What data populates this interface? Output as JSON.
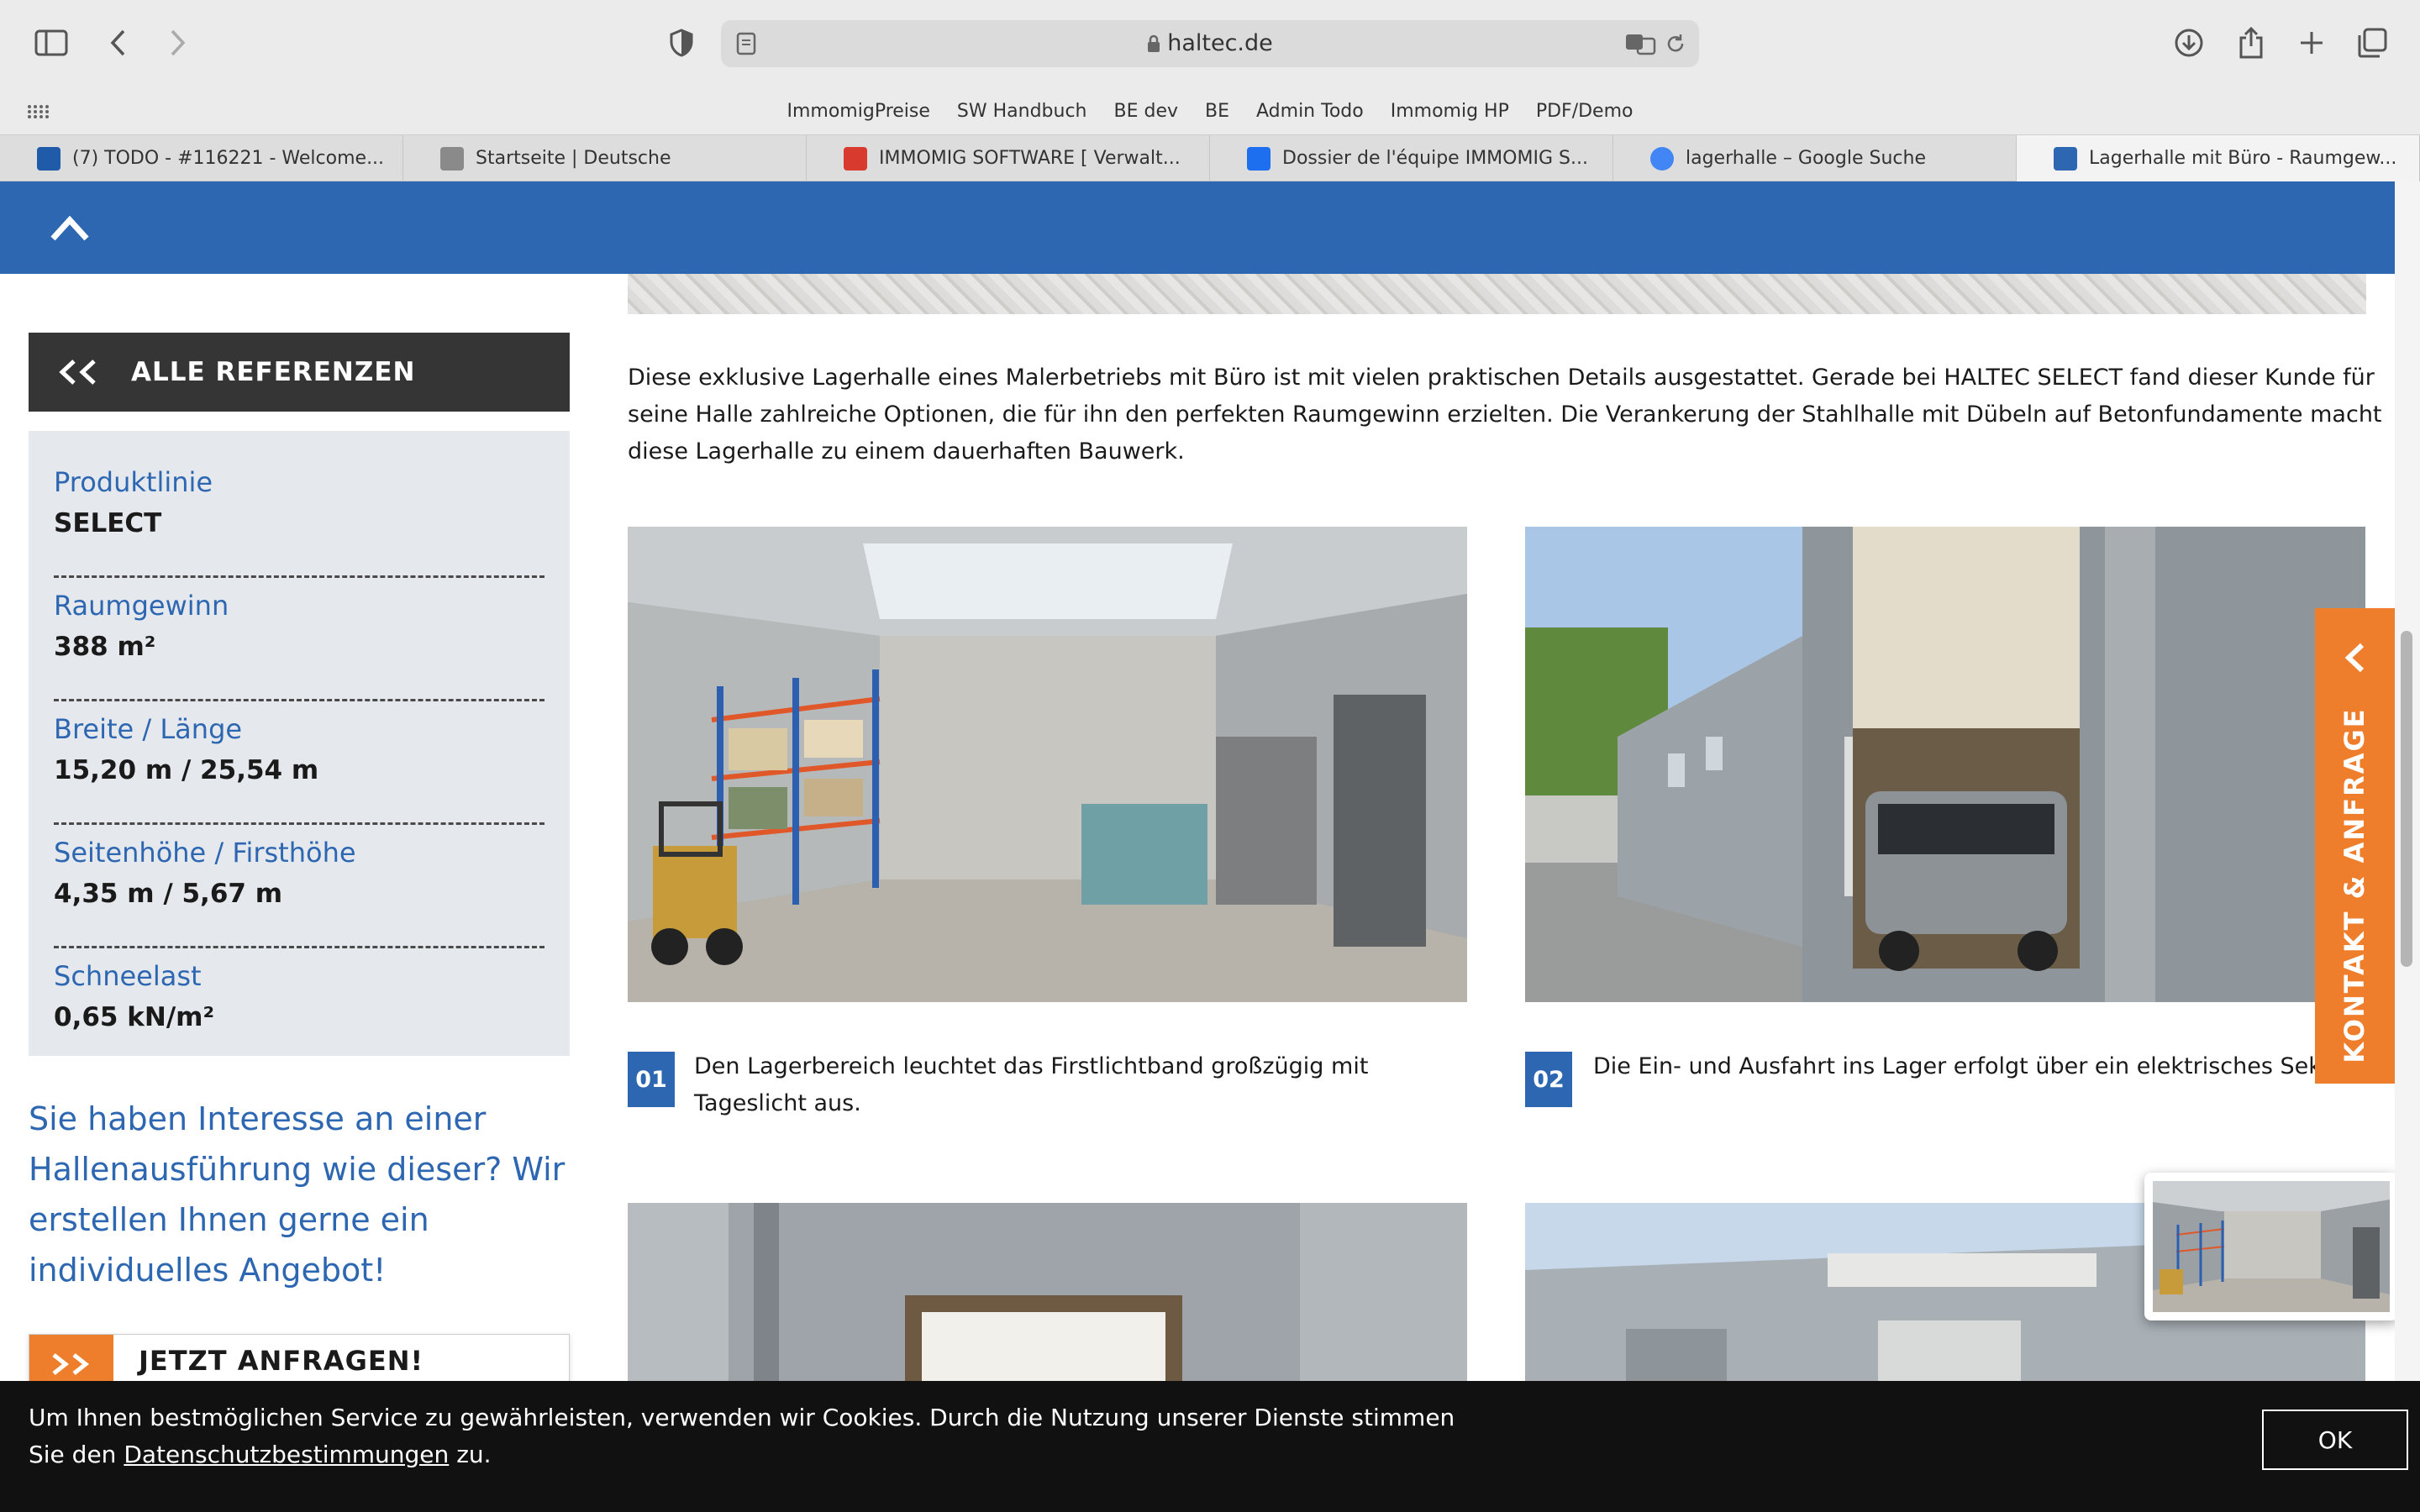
{
  "browser": {
    "url": "haltec.de",
    "favorites": [
      "ImmomigPreise",
      "SW Handbuch",
      "BE dev",
      "BE",
      "Admin Todo",
      "Immomig HP",
      "PDF/Demo"
    ],
    "tabs": [
      {
        "title": "(7) TODO - #116221 - Welcome...",
        "color": "#1f5ba8"
      },
      {
        "title": "Startseite | Deutsche",
        "color": "#8a8a8a"
      },
      {
        "title": "IMMOMIG SOFTWARE [ Verwalt...",
        "color": "#d83a2e"
      },
      {
        "title": "Dossier de l'équipe IMMOMIG S...",
        "color": "#1e6ff0"
      },
      {
        "title": "lagerhalle – Google Suche",
        "color": "#4285f4"
      },
      {
        "title": "Lagerhalle mit Büro - Raumgew...",
        "color": "#2e67b1"
      }
    ]
  },
  "sidebar": {
    "back_label": "ALLE REFERENZEN",
    "facts": [
      {
        "label": "Produktlinie",
        "value": "SELECT"
      },
      {
        "label": "Raumgewinn",
        "value": "388 m²"
      },
      {
        "label": "Breite / Länge",
        "value": "15,20 m / 25,54 m"
      },
      {
        "label": "Seitenhöhe / Firsthöhe",
        "value": "4,35 m / 5,67 m"
      },
      {
        "label": "Schneelast",
        "value": "0,65 kN/m²"
      }
    ],
    "interest_text": "Sie haben Interesse an einer Hallenausführung wie dieser? Wir erstellen Ihnen gerne ein individuelles Angebot!",
    "cta_label": "JETZT ANFRAGEN!"
  },
  "main": {
    "description": "Diese exklusive Lagerhalle eines Malerbetriebs mit Büro ist mit vielen praktischen Details ausgestattet. Gerade bei HALTEC SELECT fand dieser Kunde für seine Halle zahlreiche Optionen, die für ihn den perfekten Raumgewinn erzielten. Die Verankerung der Stahlhalle mit Dübeln auf Betonfundamente macht diese Lagerhalle zu einem dauerhaften Bauwerk.",
    "gallery": [
      {
        "num": "01",
        "caption": "Den Lagerbereich leuchtet das Firstlichtband großzügig mit Tageslicht aus."
      },
      {
        "num": "02",
        "caption": "Die Ein- und Ausfahrt ins Lager erfolgt über ein elektrisches Sektionaltor."
      }
    ]
  },
  "kontakt_label": "KONTAKT & ANFRAGE",
  "cookie": {
    "text_before": "Um Ihnen bestmöglichen Service zu gewährleisten, verwenden wir Cookies. Durch die Nutzung unserer Dienste stimmen Sie den ",
    "link": "Datenschutzbestimmungen",
    "text_after": " zu.",
    "ok_label": "OK"
  },
  "colors": {
    "brand_blue": "#2e67b1",
    "accent_orange": "#ee7d2c",
    "sidebar_bg": "#e5e9ee"
  }
}
